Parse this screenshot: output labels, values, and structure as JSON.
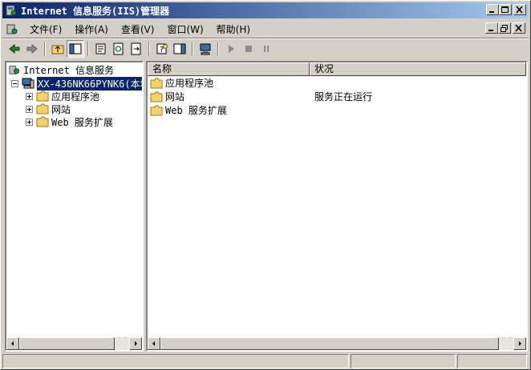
{
  "window": {
    "title": "Internet 信息服务(IIS)管理器"
  },
  "menu": {
    "items": [
      "文件(F)",
      "操作(A)",
      "查看(V)",
      "窗口(W)",
      "帮助(H)"
    ]
  },
  "tree": {
    "root": "Internet 信息服务",
    "server": "XX-436NK66PYNK6(本地计",
    "children": [
      "应用程序池",
      "网站",
      "Web 服务扩展"
    ]
  },
  "list": {
    "columns": [
      "名称",
      "状况"
    ],
    "rows": [
      {
        "name": "应用程序池",
        "status": ""
      },
      {
        "name": "网站",
        "status": "服务正在运行"
      },
      {
        "name": "Web 服务扩展",
        "status": ""
      }
    ]
  },
  "icons": {
    "app": "iis-icon",
    "folder": "folder-icon",
    "server": "computer-icon"
  },
  "colors": {
    "title_start": "#0a246a",
    "title_end": "#a6caf0",
    "selection": "#0a246a",
    "folder": "#f5d36b"
  }
}
